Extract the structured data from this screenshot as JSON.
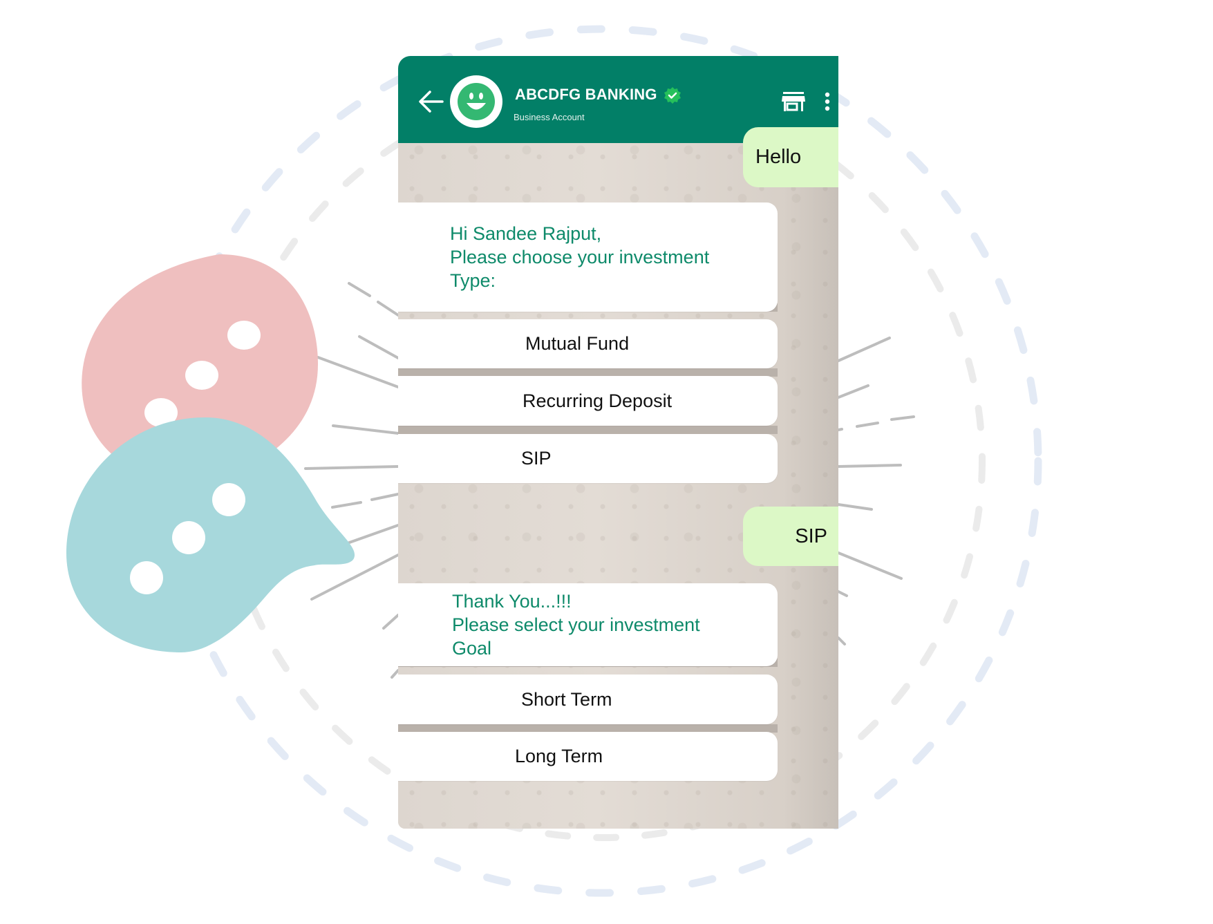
{
  "header": {
    "title": "ABCDFG BANKING",
    "subtitle": "Business Account",
    "verified": true,
    "icons": [
      "back-arrow-icon",
      "smiley-avatar-icon",
      "verified-badge-icon",
      "store-icon",
      "more-vertical-icon"
    ]
  },
  "messages": [
    {
      "type": "outgoing",
      "text": "Hello"
    },
    {
      "type": "incoming",
      "lines": [
        "Hi Sandee Rajput,",
        "Please choose your investment",
        "Type:"
      ]
    },
    {
      "type": "options",
      "items": [
        "Mutual Fund",
        "Recurring Deposit",
        "SIP"
      ]
    },
    {
      "type": "outgoing",
      "text": "SIP"
    },
    {
      "type": "incoming",
      "lines": [
        "Thank You...!!!",
        "Please select your investment",
        "Goal"
      ]
    },
    {
      "type": "options",
      "items": [
        "Short Term",
        "Long Term"
      ]
    }
  ],
  "decor": {
    "colors": {
      "header": "#027F67",
      "outgoing_bubble": "#DCF8C6",
      "incoming_text": "#0E8A6A",
      "chat_background": "#DCD5CE",
      "pink_bubble": "#EFBFBF",
      "teal_bubble": "#A7D8DC",
      "outer_dashed_ring": "#E3EAF5",
      "inner_dashed_ring": "#EBEBEB"
    }
  }
}
